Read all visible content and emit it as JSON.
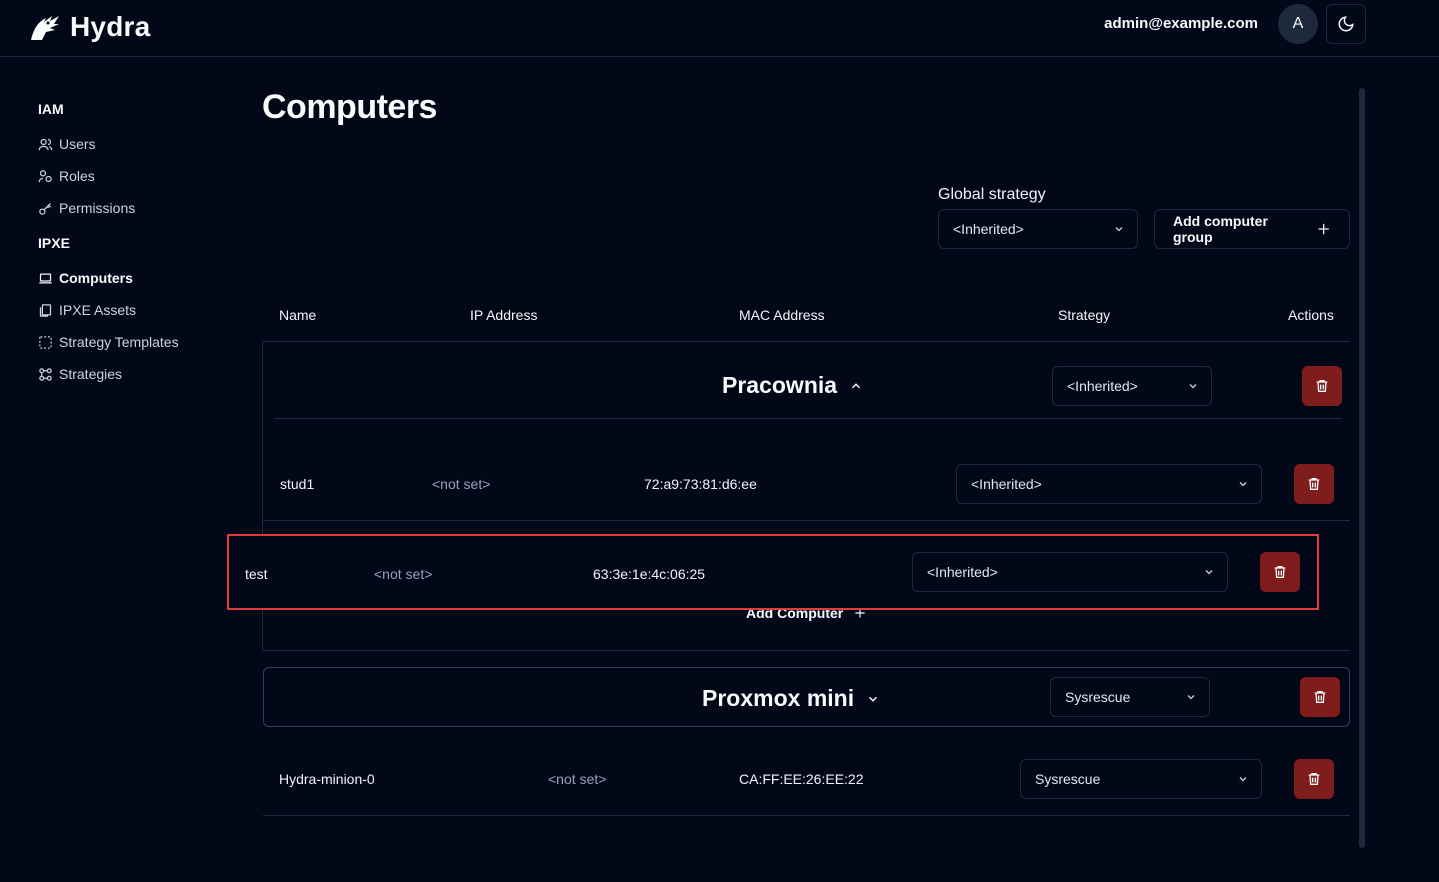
{
  "app": {
    "name": "Hydra"
  },
  "header": {
    "user_email": "admin@example.com",
    "avatar_initial": "A"
  },
  "sidebar": {
    "sections": [
      {
        "title": "IAM",
        "items": [
          {
            "label": "Users",
            "icon": "users-icon"
          },
          {
            "label": "Roles",
            "icon": "roles-icon"
          },
          {
            "label": "Permissions",
            "icon": "key-icon"
          }
        ]
      },
      {
        "title": "IPXE",
        "items": [
          {
            "label": "Computers",
            "icon": "laptop-icon",
            "active": true
          },
          {
            "label": "IPXE Assets",
            "icon": "files-icon"
          },
          {
            "label": "Strategy Templates",
            "icon": "dashed-square-icon"
          },
          {
            "label": "Strategies",
            "icon": "workflow-icon"
          }
        ]
      }
    ]
  },
  "page": {
    "title": "Computers",
    "global_strategy_label": "Global strategy",
    "global_strategy_value": "<Inherited>",
    "add_group_label": "Add computer group"
  },
  "table": {
    "headers": [
      "Name",
      "IP Address",
      "MAC Address",
      "Strategy",
      "Actions"
    ]
  },
  "groups": [
    {
      "name": "Pracownia",
      "expanded": true,
      "strategy": "<Inherited>",
      "computers": [
        {
          "name": "stud1",
          "ip": "<not set>",
          "mac": "72:a9:73:81:d6:ee",
          "strategy": "<Inherited>"
        },
        {
          "name": "test",
          "ip": "<not set>",
          "mac": "63:3e:1e:4c:06:25",
          "strategy": "<Inherited>"
        }
      ],
      "add_computer_label": "Add Computer"
    },
    {
      "name": "Proxmox mini",
      "expanded": false,
      "strategy": "Sysrescue",
      "computers": [
        {
          "name": "Hydra-minion-0",
          "ip": "<not set>",
          "mac": "CA:FF:EE:26:EE:22",
          "strategy": "Sysrescue"
        }
      ]
    }
  ],
  "colors": {
    "background": "#020817",
    "border": "#1e293b",
    "danger": "#7f1d1d",
    "highlight": "#e03a3a"
  }
}
